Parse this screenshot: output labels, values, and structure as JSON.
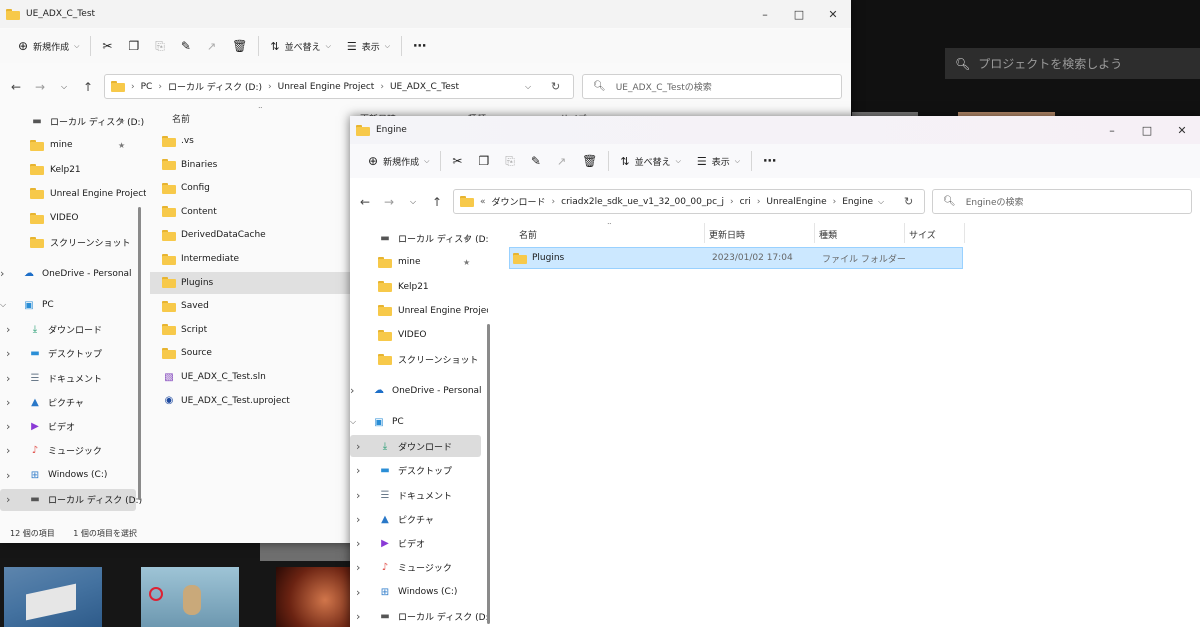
{
  "background": {
    "search_placeholder": "プロジェクトを検索しよう"
  },
  "win1": {
    "title": "UE_ADX_C_Test",
    "toolbar": {
      "new_label": "新規作成",
      "sort_label": "並べ替え",
      "view_label": "表示"
    },
    "breadcrumb": [
      "PC",
      "ローカル ディスク (D:)",
      "Unreal Engine Project",
      "UE_ADX_C_Test"
    ],
    "search_placeholder": "UE_ADX_C_Testの検索",
    "columns": {
      "name": "名前",
      "date": "更新日時",
      "type": "種類",
      "size": "サイズ"
    },
    "nav_quick": [
      {
        "label": "ローカル ディスク (D:)",
        "icon": "drive-icon",
        "pinned": true
      },
      {
        "label": "mine",
        "icon": "folder-icon",
        "pinned": true
      },
      {
        "label": "Kelp21",
        "icon": "folder-icon",
        "pinned": false
      },
      {
        "label": "Unreal Engine Project",
        "icon": "folder-icon",
        "pinned": false
      },
      {
        "label": "VIDEO",
        "icon": "folder-icon",
        "pinned": false
      },
      {
        "label": "スクリーンショット",
        "icon": "folder-icon",
        "pinned": false
      }
    ],
    "onedrive": "OneDrive - Personal",
    "pc": "PC",
    "pc_children": [
      {
        "label": "ダウンロード",
        "icon": "download-icon"
      },
      {
        "label": "デスクトップ",
        "icon": "desktop-icon"
      },
      {
        "label": "ドキュメント",
        "icon": "document-icon"
      },
      {
        "label": "ピクチャ",
        "icon": "picture-icon"
      },
      {
        "label": "ビデオ",
        "icon": "video-icon"
      },
      {
        "label": "ミュージック",
        "icon": "music-icon"
      },
      {
        "label": "Windows (C:)",
        "icon": "windows-drive-icon"
      },
      {
        "label": "ローカル ディスク (D:)",
        "icon": "drive-icon"
      }
    ],
    "files": [
      {
        "name": ".vs",
        "icon": "folder-icon"
      },
      {
        "name": "Binaries",
        "icon": "folder-icon"
      },
      {
        "name": "Config",
        "icon": "folder-icon"
      },
      {
        "name": "Content",
        "icon": "folder-icon"
      },
      {
        "name": "DerivedDataCache",
        "icon": "folder-icon"
      },
      {
        "name": "Intermediate",
        "icon": "folder-icon"
      },
      {
        "name": "Plugins",
        "icon": "folder-icon"
      },
      {
        "name": "Saved",
        "icon": "folder-icon"
      },
      {
        "name": "Script",
        "icon": "folder-icon"
      },
      {
        "name": "Source",
        "icon": "folder-icon"
      },
      {
        "name": "UE_ADX_C_Test.sln",
        "icon": "solution-file-icon"
      },
      {
        "name": "UE_ADX_C_Test.uproject",
        "icon": "unreal-project-icon"
      }
    ],
    "status_count": "12 個の項目",
    "status_selected": "1 個の項目を選択"
  },
  "win2": {
    "title": "Engine",
    "toolbar": {
      "new_label": "新規作成",
      "sort_label": "並べ替え",
      "view_label": "表示"
    },
    "breadcrumb_overflow": "«",
    "breadcrumb": [
      "ダウンロード",
      "criadx2le_sdk_ue_v1_32_00_00_pc_j",
      "cri",
      "UnrealEngine",
      "Engine"
    ],
    "search_placeholder": "Engineの検索",
    "columns": {
      "name": "名前",
      "date": "更新日時",
      "type": "種類",
      "size": "サイズ"
    },
    "nav_quick": [
      {
        "label": "ローカル ディスク (D:)",
        "icon": "drive-icon",
        "pinned": true
      },
      {
        "label": "mine",
        "icon": "folder-icon",
        "pinned": true
      },
      {
        "label": "Kelp21",
        "icon": "folder-icon",
        "pinned": false
      },
      {
        "label": "Unreal Engine Project",
        "icon": "folder-icon",
        "pinned": false
      },
      {
        "label": "VIDEO",
        "icon": "folder-icon",
        "pinned": false
      },
      {
        "label": "スクリーンショット",
        "icon": "folder-icon",
        "pinned": false
      }
    ],
    "onedrive": "OneDrive - Personal",
    "pc": "PC",
    "pc_children": [
      {
        "label": "ダウンロード",
        "icon": "download-icon"
      },
      {
        "label": "デスクトップ",
        "icon": "desktop-icon"
      },
      {
        "label": "ドキュメント",
        "icon": "document-icon"
      },
      {
        "label": "ピクチャ",
        "icon": "picture-icon"
      },
      {
        "label": "ビデオ",
        "icon": "video-icon"
      },
      {
        "label": "ミュージック",
        "icon": "music-icon"
      },
      {
        "label": "Windows (C:)",
        "icon": "windows-drive-icon"
      },
      {
        "label": "ローカル ディスク (D:)",
        "icon": "drive-icon"
      }
    ],
    "files": [
      {
        "name": "Plugins",
        "date": "2023/01/02 17:04",
        "type": "ファイル フォルダー",
        "size": ""
      }
    ]
  },
  "colors": {
    "accent": "#0067c0",
    "selection_fill": "#cce8ff",
    "selection_border": "#99d1ff",
    "folder": "#f7c94a"
  }
}
